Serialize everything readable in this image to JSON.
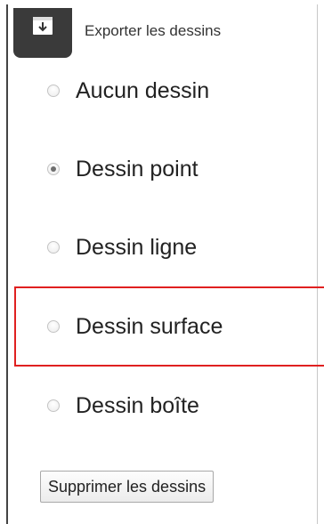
{
  "header": {
    "title": "Exporter les dessins",
    "icon": "download-icon"
  },
  "options": [
    {
      "label": "Aucun dessin",
      "checked": false
    },
    {
      "label": "Dessin point",
      "checked": true
    },
    {
      "label": "Dessin ligne",
      "checked": false
    },
    {
      "label": "Dessin surface",
      "checked": false
    },
    {
      "label": "Dessin boîte",
      "checked": false
    }
  ],
  "actions": {
    "delete_label": "Supprimer les dessins"
  },
  "colors": {
    "highlight": "#e02020",
    "header_button": "#3a3a3a"
  }
}
